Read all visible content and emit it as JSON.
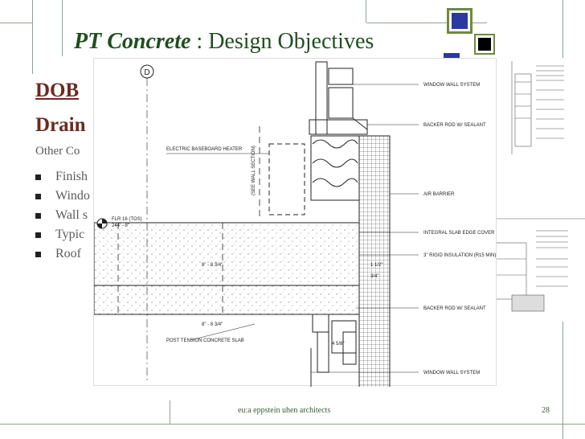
{
  "slide": {
    "title_bold": "PT Concrete",
    "title_rest": " : Design Objectives",
    "heading1": "DOB",
    "heading2": "Drain",
    "other_label": "Other Co",
    "bullets": [
      "Finish",
      "Windo",
      "Wall s",
      "Typic",
      "Roof"
    ]
  },
  "drawing": {
    "grid_marker": "D",
    "labels": {
      "window_wall_system_top": "WINDOW WALL SYSTEM",
      "backer_rod_top": "BACKER ROD W/ SEALANT",
      "electric_heater": "ELECTRIC BASEBOARD HEATER",
      "see_wall_section": "(SEE WALL SECTION)",
      "air_barrier": "AIR BARRIER",
      "flr_level": "FLR 16 (TOS)",
      "flr_elevation": "244' - 8\"",
      "slab_edge_cover": "INTEGRAL SLAB EDGE COVER",
      "rigid_insulation": "3\" RIGID INSULATION (R15 MIN)",
      "dim_slab_1": "8\" - 8 3/4\"",
      "dim_1_half": "1 1/2\"",
      "dim_3_4": "3/4\"",
      "backer_rod_bottom": "BACKER ROD W/ SEALANT",
      "dim_slab_2": "8\" - 8 3/4\"",
      "pt_slab": "POST TENSION CONCRETE SLAB",
      "dim_4_5_8": "4 5/8\"",
      "window_wall_system_bottom": "WINDOW WALL SYSTEM"
    }
  },
  "footer": {
    "text": "eu:a   eppstein uhen architects",
    "page_number": "28"
  },
  "colors": {
    "title": "#1f4e1f",
    "heading": "#6b2a1f",
    "body_text": "#5a5a5a",
    "deco_green": "#6e8b3d",
    "deco_blue": "#2b3aa0",
    "deco_black": "#000000"
  }
}
